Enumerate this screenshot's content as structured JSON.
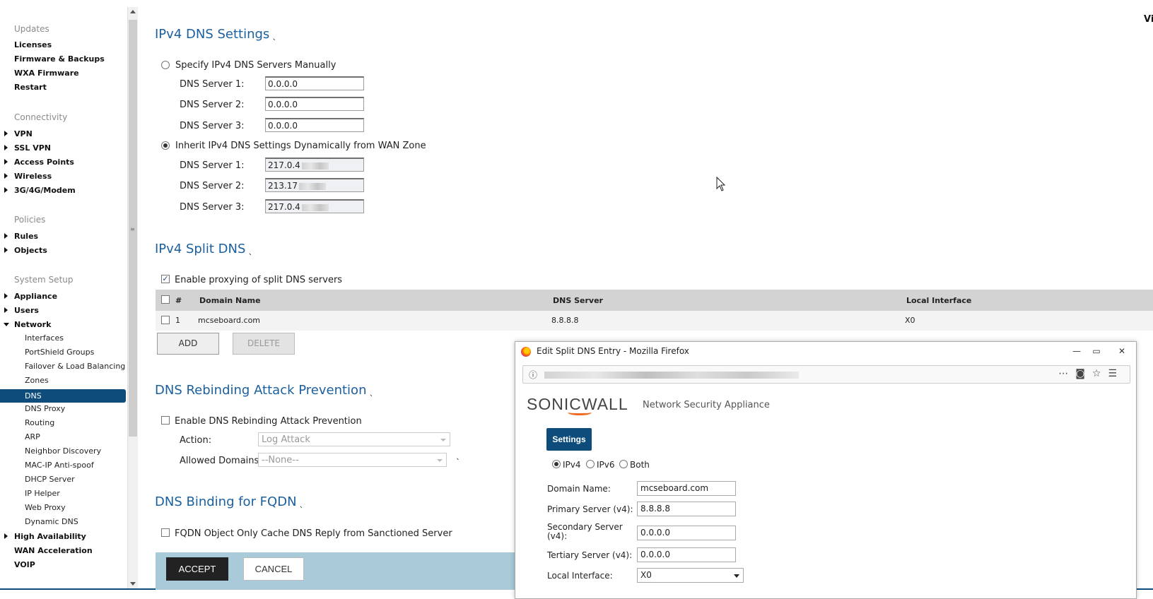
{
  "sidebar": {
    "groups": [
      {
        "heading": "Updates",
        "items": [
          "Licenses",
          "Firmware & Backups",
          "WXA Firmware",
          "Restart"
        ]
      },
      {
        "heading": "Connectivity",
        "items": [
          "VPN",
          "SSL VPN",
          "Access Points",
          "Wireless",
          "3G/4G/Modem"
        ]
      },
      {
        "heading": "Policies",
        "items": [
          "Rules",
          "Objects"
        ]
      },
      {
        "heading": "System Setup",
        "items": [
          "Appliance",
          "Users",
          "Network"
        ]
      }
    ],
    "network_sub": [
      "Interfaces",
      "PortShield Groups",
      "Failover & Load Balancing",
      "Zones",
      "DNS",
      "DNS Proxy",
      "Routing",
      "ARP",
      "Neighbor Discovery",
      "MAC-IP Anti-spoof",
      "DHCP Server",
      "IP Helper",
      "Web Proxy",
      "Dynamic DNS"
    ],
    "after": [
      "High Availability",
      "WAN Acceleration",
      "VOIP"
    ],
    "active": "DNS"
  },
  "ipv4_dns": {
    "title": "IPv4 DNS Settings",
    "manual_label": "Specify IPv4 DNS Servers Manually",
    "manual_servers": [
      {
        "label": "DNS Server 1:",
        "value": "0.0.0.0"
      },
      {
        "label": "DNS Server 2:",
        "value": "0.0.0.0"
      },
      {
        "label": "DNS Server 3:",
        "value": "0.0.0.0"
      }
    ],
    "inherit_label": "Inherit IPv4 DNS Settings Dynamically from WAN Zone",
    "inherit_servers": [
      {
        "label": "DNS Server 1:",
        "value": "217.0.4"
      },
      {
        "label": "DNS Server 2:",
        "value": "213.17"
      },
      {
        "label": "DNS Server 3:",
        "value": "217.0.4"
      }
    ]
  },
  "split_dns": {
    "title": "IPv4 Split DNS",
    "enable_label": "Enable proxying of split DNS servers",
    "columns": [
      "#",
      "Domain Name",
      "DNS Server",
      "Local Interface"
    ],
    "rows": [
      {
        "num": "1",
        "domain": "mcseboard.com",
        "server": "8.8.8.8",
        "iface": "X0"
      }
    ],
    "add_label": "ADD",
    "delete_label": "DELETE"
  },
  "rebinding": {
    "title": "DNS Rebinding Attack Prevention",
    "enable_label": "Enable DNS Rebinding Attack Prevention",
    "action_label": "Action:",
    "action_value": "Log Attack",
    "domains_label": "Allowed Domains:",
    "domains_value": "--None--"
  },
  "fqdn": {
    "title": "DNS Binding for FQDN",
    "option_label": "FQDN Object Only Cache DNS Reply from Sanctioned Server"
  },
  "footer": {
    "accept": "ACCEPT",
    "cancel": "CANCEL"
  },
  "right_edge_text": "Vi",
  "popup": {
    "window_title": "Edit Split DNS Entry - Mozilla Firefox",
    "brand_main": "SONICWALL",
    "brand_sub": "Network Security Appliance",
    "settings_btn": "Settings",
    "ip_options": [
      "IPv4",
      "IPv6",
      "Both"
    ],
    "fields": [
      {
        "label": "Domain Name:",
        "value": "mcseboard.com"
      },
      {
        "label": "Primary Server (v4):",
        "value": "8.8.8.8"
      },
      {
        "label": "Secondary Server (v4):",
        "value": "0.0.0.0"
      },
      {
        "label": "Tertiary Server (v4):",
        "value": "0.0.0.0"
      }
    ],
    "iface_label": "Local Interface:",
    "iface_value": "X0"
  }
}
